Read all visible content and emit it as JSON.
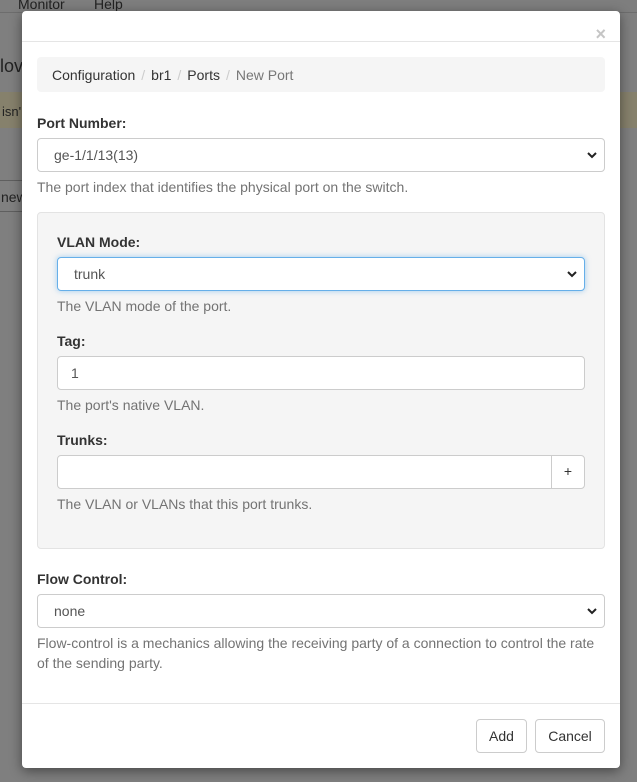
{
  "background": {
    "nav_items": [
      "Monitor",
      "Help"
    ],
    "title_fragment": "lov",
    "alert_fragment": "isn'",
    "button_fragment": "new"
  },
  "modal": {
    "close_label": "×",
    "breadcrumb": [
      "Configuration",
      "br1",
      "Ports",
      "New Port"
    ],
    "port_number": {
      "label": "Port Number:",
      "value": "ge-1/1/13(13)",
      "help": "The port index that identifies the physical port on the switch."
    },
    "vlan_mode": {
      "label": "VLAN Mode:",
      "value": "trunk",
      "help": "The VLAN mode of the port."
    },
    "tag": {
      "label": "Tag:",
      "value": "1",
      "help": "The port's native VLAN."
    },
    "trunks": {
      "label": "Trunks:",
      "value": "",
      "add_label": "+",
      "help": "The VLAN or VLANs that this port trunks."
    },
    "flow_control": {
      "label": "Flow Control:",
      "value": "none",
      "help_line1": "Flow-control is a mechanics allowing the receiving party of a connection to control the rate",
      "help_line2": "of the sending party."
    },
    "footer": {
      "add_label": "Add",
      "cancel_label": "Cancel"
    }
  },
  "icons": {
    "select_arrow": "chevron-down-icon",
    "close": "close-icon"
  }
}
